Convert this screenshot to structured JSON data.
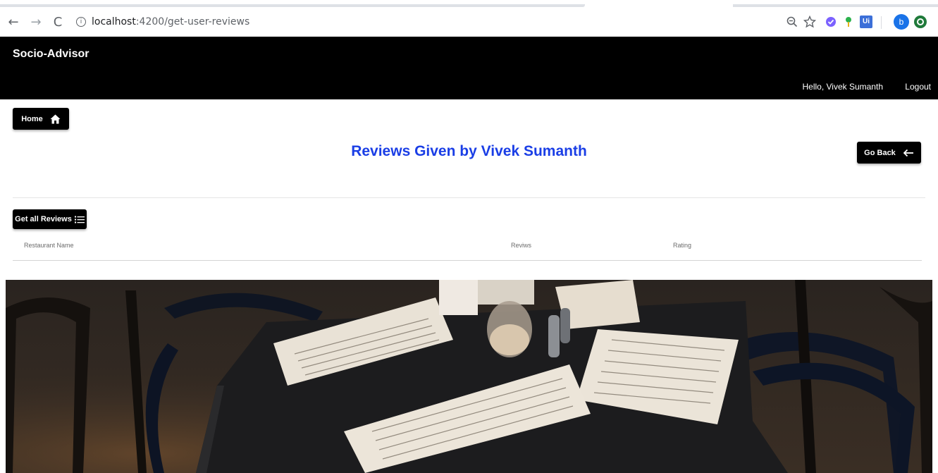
{
  "browser": {
    "url_host": "localhost",
    "url_port_path": ":4200/get-user-reviews",
    "back_icon": "arrow-left-icon",
    "forward_icon": "arrow-right-icon",
    "reload_icon": "reload-icon",
    "extension_letter_u": "Ui",
    "profile_letter": "b"
  },
  "header": {
    "brand": "Socio-Advisor",
    "greeting": "Hello, Vivek Sumanth",
    "logout": "Logout"
  },
  "home_button": {
    "label": "Home",
    "icon": "home-icon"
  },
  "page_title": "Reviews Given by Vivek Sumanth",
  "go_back_button": {
    "label": "Go Back",
    "icon": "arrow-left-icon"
  },
  "get_all_button": {
    "label": "Get all Reviews",
    "icon": "list-icon"
  },
  "table": {
    "columns": [
      "Restaurant Name",
      "Reviws",
      "Rating"
    ]
  },
  "colors": {
    "header_bg": "#000000",
    "title": "#1a3ee6",
    "button_bg": "#000000"
  }
}
